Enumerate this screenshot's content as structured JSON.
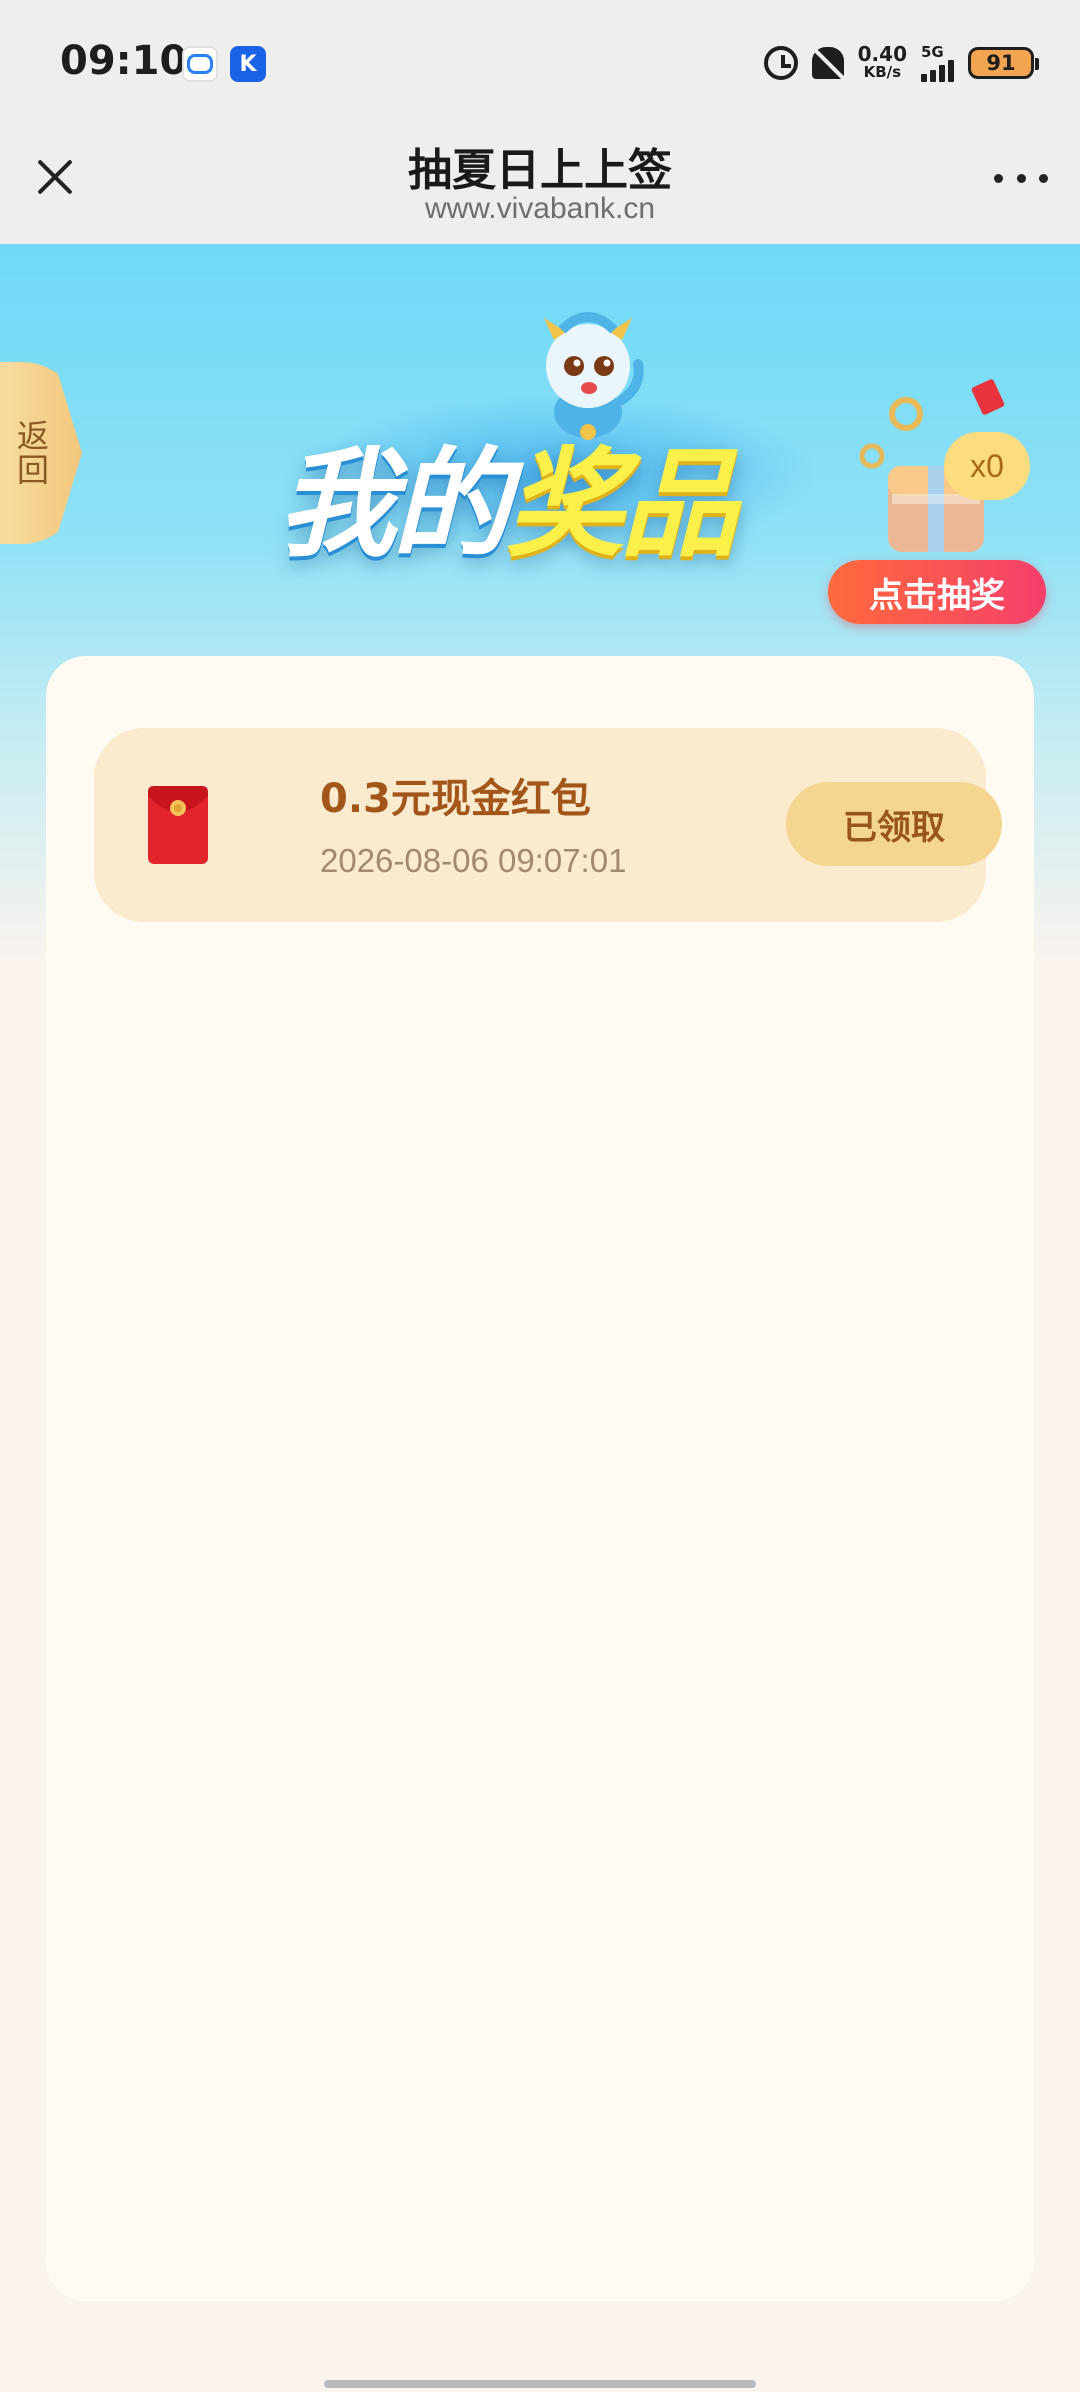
{
  "status_bar": {
    "time": "09:10",
    "app_icon_k": "K",
    "net_speed_value": "0.40",
    "net_speed_unit": "KB/s",
    "network": "5G",
    "battery": "91"
  },
  "title_bar": {
    "title": "抽夏日上上签",
    "url": "www.vivabank.cn"
  },
  "banner": {
    "back_label": "返回",
    "title_part1": "我的",
    "title_part2": "奖品",
    "draw_count": "x0",
    "draw_button": "点击抽奖"
  },
  "prizes": [
    {
      "name": "0.3元现金红包",
      "time": "2026-08-06 09:07:01",
      "status": "已领取"
    }
  ],
  "colors": {
    "accent": "#f53f6b",
    "card_row": "#faebce",
    "claimed_button": "#f5d691",
    "prize_text": "#a3561a"
  }
}
